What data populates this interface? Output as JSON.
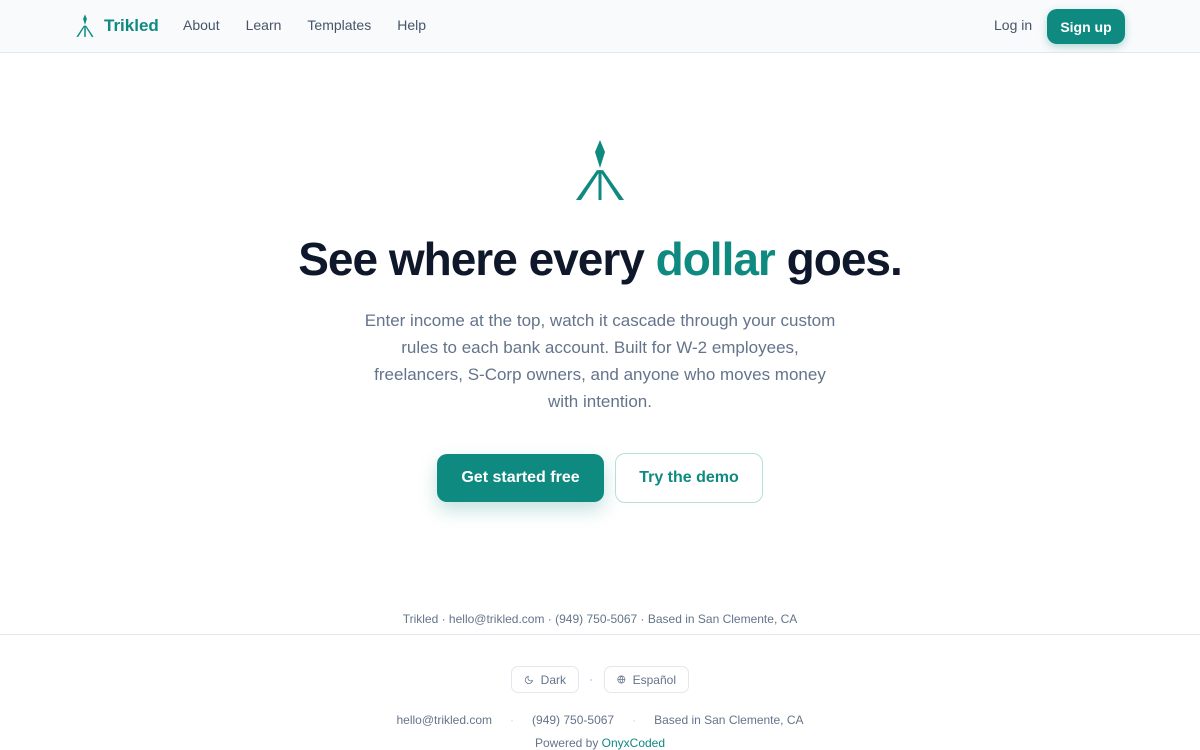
{
  "header": {
    "brand": "Trikled",
    "nav": [
      "About",
      "Learn",
      "Templates",
      "Help"
    ],
    "login_label": "Log in",
    "signup_label": "Sign up"
  },
  "hero": {
    "headline_before": "See where every ",
    "headline_accent": "dollar",
    "headline_after": " goes.",
    "subtext": "Enter income at the top, watch it cascade through your custom rules to each bank account. Built for W-2 employees, freelancers, S-Corp owners, and anyone who moves money with intention.",
    "primary_cta": "Get started free",
    "secondary_cta": "Try the demo"
  },
  "contact_line": "Trikled · hello@trikled.com · (949) 750-5067 · Based in San Clemente, CA",
  "footer": {
    "theme_toggle": "Dark",
    "theme_icon": "moon-icon",
    "language_toggle": "Español",
    "language_icon": "globe-icon",
    "email": "hello@trikled.com",
    "phone": "(949) 750-5067",
    "location": "Based in San Clemente, CA",
    "powered_prefix": "Powered by ",
    "powered_link": "OnyxCoded"
  },
  "colors": {
    "accent": "#0f8a80",
    "text": "#0f172a",
    "muted": "#64748b",
    "border": "#e2e8f0"
  }
}
